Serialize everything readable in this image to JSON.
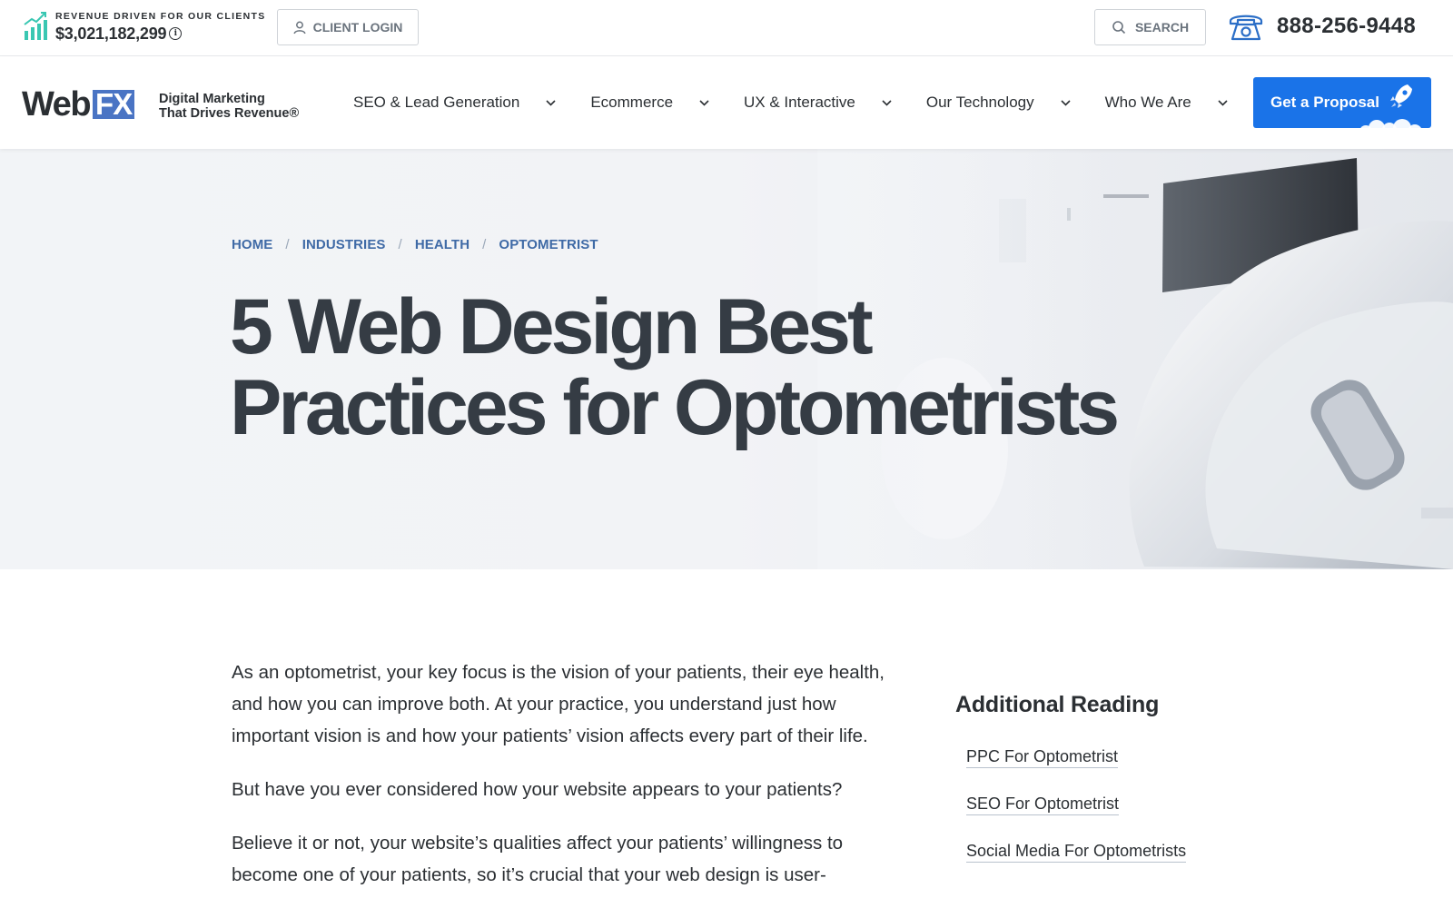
{
  "topbar": {
    "revenue_label": "REVENUE DRIVEN FOR OUR CLIENTS",
    "revenue_amount": "$3,021,182,299",
    "info_glyph": "i",
    "client_login": "CLIENT LOGIN",
    "search": "SEARCH",
    "phone": "888-256-9448"
  },
  "nav": {
    "logo_web": "Web",
    "logo_fx": "FX",
    "tagline_line1": "Digital Marketing",
    "tagline_line2": "That Drives Revenue®",
    "items": [
      {
        "label": "SEO & Lead Generation"
      },
      {
        "label": "Ecommerce"
      },
      {
        "label": "UX & Interactive"
      },
      {
        "label": "Our Technology"
      },
      {
        "label": "Who We Are"
      }
    ],
    "cta": "Get a Proposal"
  },
  "hero": {
    "breadcrumb": [
      "HOME",
      "INDUSTRIES",
      "HEALTH",
      "OPTOMETRIST"
    ],
    "breadcrumb_separator": "/",
    "title_line1": "5 Web Design Best",
    "title_line2": "Practices for Optometrists"
  },
  "article": {
    "paragraphs": [
      "As an optometrist, your key focus is the vision of your patients, their eye health, and how you can improve both. At your practice, you understand just how important vision is and how your patients’ vision affects every part of their life.",
      "But have you ever considered how your website appears to your patients?",
      "Believe it or not, your website’s qualities affect your patients’ willingness to become one of your patients, so it’s crucial that your web design is user-"
    ]
  },
  "sidebar": {
    "heading": "Additional Reading",
    "links": [
      "PPC For Optometrist",
      "SEO For Optometrist",
      "Social Media For Optometrists"
    ]
  },
  "colors": {
    "brand_blue": "#4a74c4",
    "cta_blue": "#1a73e8",
    "breadcrumb_blue": "#3f6aa6",
    "chart_teal": "#39c7b2",
    "text_dark": "#2b2f33"
  },
  "icons": [
    "revenue-chart-icon",
    "info-icon",
    "user-icon",
    "search-icon",
    "phone-icon",
    "chevron-down-icon",
    "rocket-icon"
  ]
}
